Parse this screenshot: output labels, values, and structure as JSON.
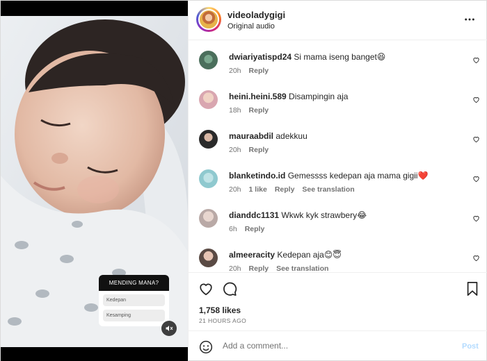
{
  "post": {
    "username": "videoladygigi",
    "audio": "Original audio"
  },
  "media": {
    "poll_question": "MENDING MANA?",
    "poll_options": [
      "Kedepan",
      "Kesamping"
    ]
  },
  "comments": [
    {
      "user": "dwiariyatispd24",
      "text": "Si mama iseng banget😆",
      "time": "20h",
      "likes": "",
      "reply": "Reply",
      "translation": ""
    },
    {
      "user": "heini.heini.589",
      "text": "Disampingin aja",
      "time": "18h",
      "likes": "",
      "reply": "Reply",
      "translation": ""
    },
    {
      "user": "mauraabdil",
      "text": "adekkuu",
      "time": "20h",
      "likes": "",
      "reply": "Reply",
      "translation": ""
    },
    {
      "user": "blanketindo.id",
      "text": "Gemessss kedepan aja mama gigii❤️",
      "time": "20h",
      "likes": "1 like",
      "reply": "Reply",
      "translation": "See translation"
    },
    {
      "user": "dianddc1131",
      "text": "Wkwk kyk strawbery😂",
      "time": "6h",
      "likes": "",
      "reply": "Reply",
      "translation": ""
    },
    {
      "user": "almeeracity",
      "text": "Kedepan aja😊😇",
      "time": "20h",
      "likes": "",
      "reply": "Reply",
      "translation": "See translation"
    }
  ],
  "stats": {
    "likes": "1,758 likes",
    "posted": "21 HOURS AGO"
  },
  "composer": {
    "placeholder": "Add a comment...",
    "post_label": "Post"
  },
  "colors": {
    "post_disabled": "#b3dbff",
    "secondary_text": "#737373"
  },
  "icons": [
    "more-icon",
    "heart-icon",
    "comment-icon",
    "bookmark-icon",
    "emoji-icon",
    "mute-icon"
  ]
}
